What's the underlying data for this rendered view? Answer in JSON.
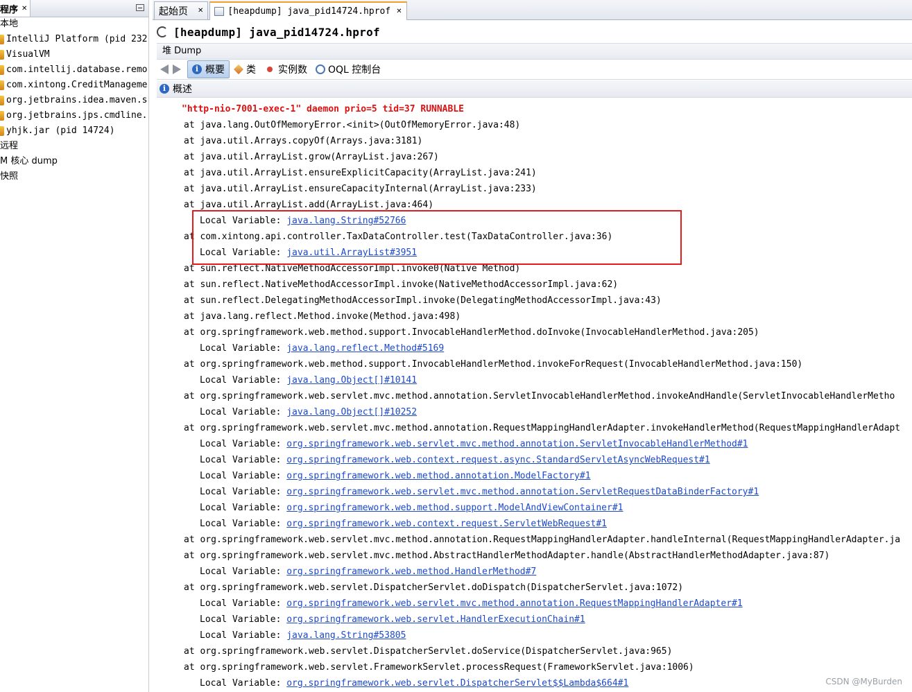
{
  "left_panel": {
    "tab_title": "程序",
    "tree": [
      {
        "label": "本地",
        "kind": "category"
      },
      {
        "label": "IntelliJ Platform (pid 232",
        "kind": "app"
      },
      {
        "label": "VisualVM",
        "kind": "app"
      },
      {
        "label": "com.intellij.database.remo",
        "kind": "app"
      },
      {
        "label": "com.xintong.CreditManageme",
        "kind": "app"
      },
      {
        "label": "org.jetbrains.idea.maven.s",
        "kind": "app"
      },
      {
        "label": "org.jetbrains.jps.cmdline.",
        "kind": "app"
      },
      {
        "label": "yhjk.jar (pid 14724)",
        "kind": "app"
      },
      {
        "label": "远程",
        "kind": "category"
      },
      {
        "label": "M 核心 dump",
        "kind": "category"
      },
      {
        "label": "快照",
        "kind": "category"
      }
    ]
  },
  "tabs": [
    {
      "label": "起始页"
    },
    {
      "label": "[heapdump] java_pid14724.hprof"
    }
  ],
  "document": {
    "title": "[heapdump] java_pid14724.hprof",
    "subheader": "堆 Dump",
    "toolbar": {
      "summary": "概要",
      "classes": "类",
      "instances": "实例数",
      "oql": "OQL 控制台"
    },
    "section_title": "概述"
  },
  "trace": [
    {
      "type": "head",
      "text": "\"http-nio-7001-exec-1\" daemon prio=5 tid=37 RUNNABLE"
    },
    {
      "type": "at",
      "text": "at java.lang.OutOfMemoryError.<init>(OutOfMemoryError.java:48)"
    },
    {
      "type": "at",
      "text": "at java.util.Arrays.copyOf(Arrays.java:3181)"
    },
    {
      "type": "at",
      "text": "at java.util.ArrayList.grow(ArrayList.java:267)"
    },
    {
      "type": "at",
      "text": "at java.util.ArrayList.ensureExplicitCapacity(ArrayList.java:241)"
    },
    {
      "type": "at",
      "text": "at java.util.ArrayList.ensureCapacityInternal(ArrayList.java:233)"
    },
    {
      "type": "at",
      "text": "at java.util.ArrayList.add(ArrayList.java:464)"
    },
    {
      "type": "lv",
      "prefix": "Local Variable: ",
      "link": "java.lang.String#52766"
    },
    {
      "type": "at",
      "text": "at com.xintong.api.controller.TaxDataController.test(TaxDataController.java:36)"
    },
    {
      "type": "lv",
      "prefix": "Local Variable: ",
      "link": "java.util.ArrayList#3951"
    },
    {
      "type": "at",
      "text": "at sun.reflect.NativeMethodAccessorImpl.invoke0(Native Method)"
    },
    {
      "type": "at",
      "text": "at sun.reflect.NativeMethodAccessorImpl.invoke(NativeMethodAccessorImpl.java:62)"
    },
    {
      "type": "at",
      "text": "at sun.reflect.DelegatingMethodAccessorImpl.invoke(DelegatingMethodAccessorImpl.java:43)"
    },
    {
      "type": "at",
      "text": "at java.lang.reflect.Method.invoke(Method.java:498)"
    },
    {
      "type": "at",
      "text": "at org.springframework.web.method.support.InvocableHandlerMethod.doInvoke(InvocableHandlerMethod.java:205)"
    },
    {
      "type": "lv",
      "prefix": "Local Variable: ",
      "link": "java.lang.reflect.Method#5169"
    },
    {
      "type": "at",
      "text": "at org.springframework.web.method.support.InvocableHandlerMethod.invokeForRequest(InvocableHandlerMethod.java:150)"
    },
    {
      "type": "lv",
      "prefix": "Local Variable: ",
      "link": "java.lang.Object[]#10141"
    },
    {
      "type": "at",
      "text": "at org.springframework.web.servlet.mvc.method.annotation.ServletInvocableHandlerMethod.invokeAndHandle(ServletInvocableHandlerMetho"
    },
    {
      "type": "lv",
      "prefix": "Local Variable: ",
      "link": "java.lang.Object[]#10252"
    },
    {
      "type": "at",
      "text": "at org.springframework.web.servlet.mvc.method.annotation.RequestMappingHandlerAdapter.invokeHandlerMethod(RequestMappingHandlerAdapt"
    },
    {
      "type": "lv",
      "prefix": "Local Variable: ",
      "link": "org.springframework.web.servlet.mvc.method.annotation.ServletInvocableHandlerMethod#1"
    },
    {
      "type": "lv",
      "prefix": "Local Variable: ",
      "link": "org.springframework.web.context.request.async.StandardServletAsyncWebRequest#1"
    },
    {
      "type": "lv",
      "prefix": "Local Variable: ",
      "link": "org.springframework.web.method.annotation.ModelFactory#1"
    },
    {
      "type": "lv",
      "prefix": "Local Variable: ",
      "link": "org.springframework.web.servlet.mvc.method.annotation.ServletRequestDataBinderFactory#1"
    },
    {
      "type": "lv",
      "prefix": "Local Variable: ",
      "link": "org.springframework.web.method.support.ModelAndViewContainer#1"
    },
    {
      "type": "lv",
      "prefix": "Local Variable: ",
      "link": "org.springframework.web.context.request.ServletWebRequest#1"
    },
    {
      "type": "at",
      "text": "at org.springframework.web.servlet.mvc.method.annotation.RequestMappingHandlerAdapter.handleInternal(RequestMappingHandlerAdapter.ja"
    },
    {
      "type": "at",
      "text": "at org.springframework.web.servlet.mvc.method.AbstractHandlerMethodAdapter.handle(AbstractHandlerMethodAdapter.java:87)"
    },
    {
      "type": "lv",
      "prefix": "Local Variable: ",
      "link": "org.springframework.web.method.HandlerMethod#7"
    },
    {
      "type": "at",
      "text": "at org.springframework.web.servlet.DispatcherServlet.doDispatch(DispatcherServlet.java:1072)"
    },
    {
      "type": "lv",
      "prefix": "Local Variable: ",
      "link": "org.springframework.web.servlet.mvc.method.annotation.RequestMappingHandlerAdapter#1"
    },
    {
      "type": "lv",
      "prefix": "Local Variable: ",
      "link": "org.springframework.web.servlet.HandlerExecutionChain#1"
    },
    {
      "type": "lv",
      "prefix": "Local Variable: ",
      "link": "java.lang.String#53805"
    },
    {
      "type": "at",
      "text": "at org.springframework.web.servlet.DispatcherServlet.doService(DispatcherServlet.java:965)"
    },
    {
      "type": "at",
      "text": "at org.springframework.web.servlet.FrameworkServlet.processRequest(FrameworkServlet.java:1006)"
    },
    {
      "type": "lv",
      "prefix": "Local Variable: ",
      "link": "org.springframework.web.servlet.DispatcherServlet$$Lambda$664#1"
    }
  ],
  "watermark": "CSDN @MyBurden",
  "colors": {
    "head": "#e01010",
    "link": "#1c49c9",
    "highlight_box": "#e51b1b",
    "active_tab_accent": "#f0a030"
  }
}
